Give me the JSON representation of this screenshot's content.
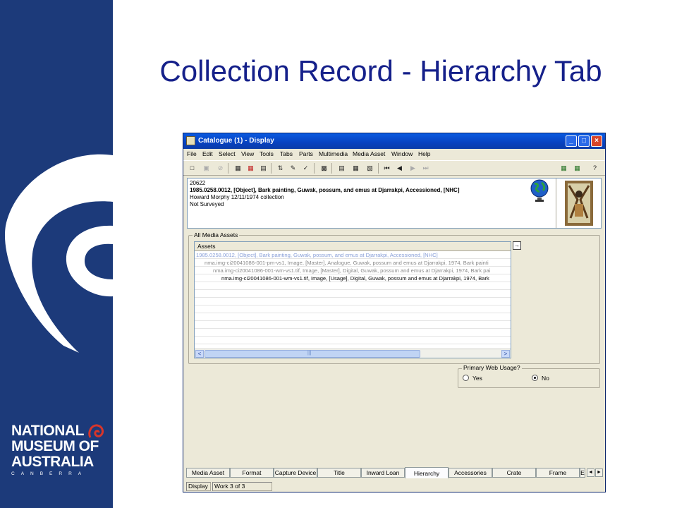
{
  "slide": {
    "title": "Collection Record - Hierarchy Tab",
    "logo": {
      "line1": "NATIONAL",
      "line2": "MUSEUM OF",
      "line3": "AUSTRALIA",
      "line4": "CANBERRA",
      "brand_color": "#1c3a7a"
    }
  },
  "window": {
    "title": "Catalogue (1) - Display",
    "controls": {
      "minimize": "_",
      "maximize": "□",
      "close": "×"
    },
    "menu": [
      "File",
      "Edit",
      "Select",
      "View",
      "Tools",
      "Tabs",
      "Parts",
      "Multimedia",
      "Media Asset",
      "Window",
      "Help"
    ],
    "toolbar_icons": [
      "new-doc-icon",
      "save-icon",
      "cancel-icon",
      "copy-icon",
      "delete-icon",
      "paste-icon",
      "sort-icon",
      "edit-icon",
      "spellcheck-icon",
      "view-icon",
      "list-icon",
      "table-icon",
      "report-icon",
      "first-record-icon",
      "prev-record-icon",
      "next-record-icon",
      "last-record-icon",
      "export-icon",
      "import-icon",
      "help-icon"
    ],
    "record": {
      "irn": "20622",
      "summary": "1985.0258.0012, [Object], Bark painting, Guwak, possum, and emus at Djarrakpi, Accessioned, [NHC]",
      "collection": "Howard Morphy 12/11/1974 collection",
      "survey": "Not Surveyed"
    },
    "media_assets": {
      "group_label": "All Media Assets",
      "column_header": "Assets",
      "rows": [
        "1985.0258.0012, [Object], Bark painting, Guwak, possum, and emus at Djarrakpi, Accessioned, [NHC]",
        "nma.img-ci20041086-001-pm-vs1, Image, [Master], Analogue, Guwak, possum and emus at Djarrakpi, 1974, Bark painti",
        "nma.img-ci20041086-001-wm-vs1.tif, Image, [Master], Digital, Guwak, possum and emus at Djarrakpi, 1974, Bark pai",
        "nma.img-ci20041086-001-wm-vs1.tif, Image, [Usage], Digital, Guwak, possum and emus at Djarrakpi, 1974, Bark"
      ],
      "scroll_left": "<",
      "scroll_right": ">",
      "scroll_grip": "|||",
      "open_button": "→"
    },
    "primary_web_usage": {
      "label": "Primary Web Usage?",
      "options": [
        "Yes",
        "No"
      ],
      "selected": "No"
    },
    "tabs": [
      "Media Asset",
      "Format",
      "Capture Device",
      "Title",
      "Inward Loan",
      "Hierarchy",
      "Accessories",
      "Crate",
      "Frame",
      "E"
    ],
    "active_tab": "Hierarchy",
    "tab_scroll": {
      "left": "◄",
      "right": "►"
    },
    "status": {
      "mode": "Display",
      "position": "Work 3 of 3"
    }
  }
}
